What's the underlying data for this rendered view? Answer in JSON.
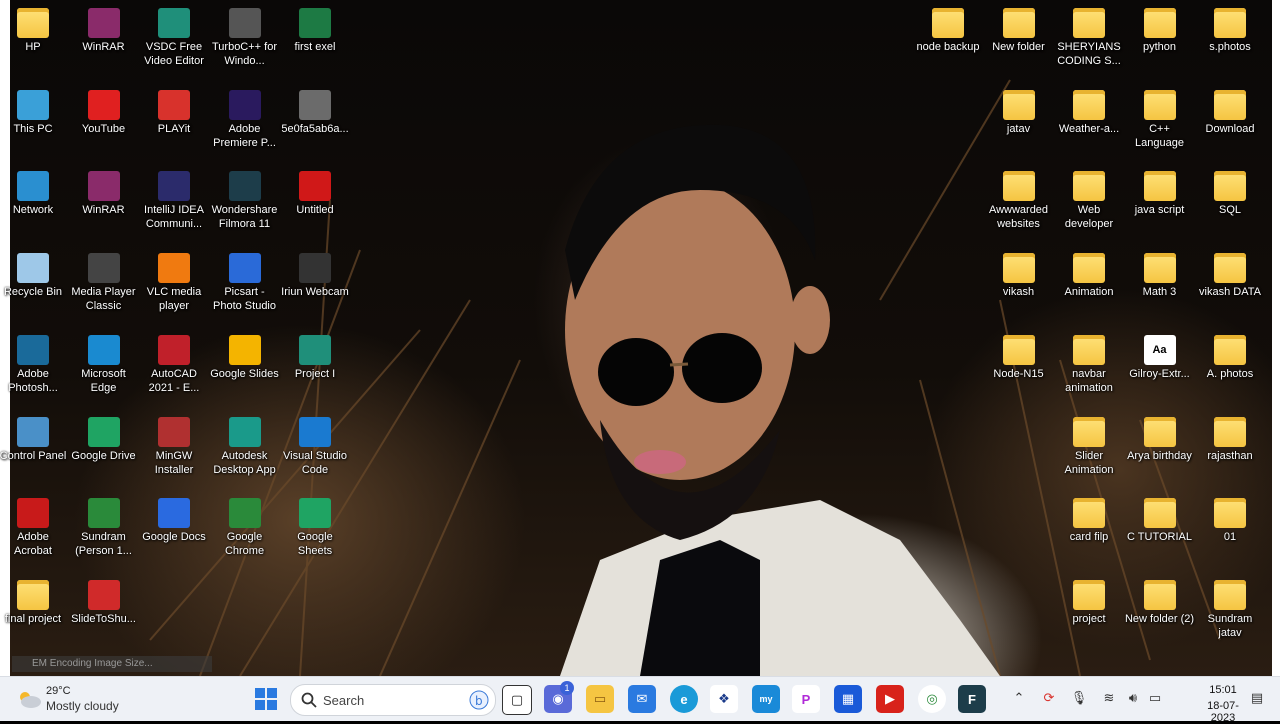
{
  "desktop_left": [
    {
      "label": "HP",
      "icon": "folder-icon",
      "color": "#f5c542"
    },
    {
      "label": "WinRAR",
      "icon": "winrar-icon",
      "color": "#8a2b6a"
    },
    {
      "label": "VSDC Free Video Editor",
      "icon": "vsdc-icon",
      "color": "#1f8f7a"
    },
    {
      "label": "TurboC++ for Windo...",
      "icon": "turboc-icon",
      "color": "#555555"
    },
    {
      "label": "first exel",
      "icon": "excel-icon",
      "color": "#1d7a44"
    },
    {
      "label": "This PC",
      "icon": "monitor-icon",
      "color": "#3aa0d8"
    },
    {
      "label": "YouTube",
      "icon": "youtube-icon",
      "color": "#e02020"
    },
    {
      "label": "PLAYit",
      "icon": "playit-icon",
      "color": "#d8322c"
    },
    {
      "label": "Adobe Premiere P...",
      "icon": "premiere-icon",
      "color": "#2a1a5e"
    },
    {
      "label": "5e0fa5ab6a...",
      "icon": "video-file-icon",
      "color": "#6b6b6b"
    },
    {
      "label": "Network",
      "icon": "network-icon",
      "color": "#2a8fd0"
    },
    {
      "label": "WinRAR",
      "icon": "winrar-icon",
      "color": "#8a2b6a"
    },
    {
      "label": "IntelliJ IDEA Communi...",
      "icon": "intellij-icon",
      "color": "#2b2b6b"
    },
    {
      "label": "Wondershare Filmora 11",
      "icon": "filmora-icon",
      "color": "#1d3d4a"
    },
    {
      "label": "Untitled",
      "icon": "red-file-icon",
      "color": "#d01818"
    },
    {
      "label": "Recycle Bin",
      "icon": "recycle-bin-icon",
      "color": "#9ec8e8"
    },
    {
      "label": "Media Player Classic",
      "icon": "media-player-icon",
      "color": "#444444"
    },
    {
      "label": "VLC media player",
      "icon": "vlc-icon",
      "color": "#f07a10"
    },
    {
      "label": "Picsart - Photo Studio",
      "icon": "picsart-icon",
      "color": "#2a6ad8"
    },
    {
      "label": "Iriun Webcam",
      "icon": "webcam-icon",
      "color": "#333333"
    },
    {
      "label": "Adobe Photosh...",
      "icon": "photoshop-icon",
      "color": "#1a6a9a"
    },
    {
      "label": "Microsoft Edge",
      "icon": "edge-icon",
      "color": "#1a8ad0"
    },
    {
      "label": "AutoCAD 2021 - E...",
      "icon": "autocad-icon",
      "color": "#c0202a"
    },
    {
      "label": "Google Slides",
      "icon": "slides-icon",
      "color": "#f4b400"
    },
    {
      "label": "Project I",
      "icon": "project-icon",
      "color": "#1f8f7a"
    },
    {
      "label": "Control Panel",
      "icon": "control-panel-icon",
      "color": "#4a90c8"
    },
    {
      "label": "Google Drive",
      "icon": "drive-icon",
      "color": "#1fa463"
    },
    {
      "label": "MinGW Installer",
      "icon": "mingw-icon",
      "color": "#b03030"
    },
    {
      "label": "Autodesk Desktop App",
      "icon": "autodesk-icon",
      "color": "#1a9a8a"
    },
    {
      "label": "Visual Studio Code",
      "icon": "vscode-icon",
      "color": "#1a7ad0"
    },
    {
      "label": "Adobe Acrobat",
      "icon": "acrobat-icon",
      "color": "#c81a1a"
    },
    {
      "label": "Sundram (Person 1...",
      "icon": "chrome-icon",
      "color": "#2a8a3a"
    },
    {
      "label": "Google Docs",
      "icon": "docs-icon",
      "color": "#2a6ae0"
    },
    {
      "label": "Google Chrome",
      "icon": "chrome-icon",
      "color": "#2a8a3a"
    },
    {
      "label": "Google Sheets",
      "icon": "sheets-icon",
      "color": "#1fa463"
    },
    {
      "label": "final project",
      "icon": "folder-icon",
      "color": "#f5c542"
    },
    {
      "label": "SlideToShu...",
      "icon": "shutdown-icon",
      "color": "#d02a2a"
    }
  ],
  "desktop_right": [
    {
      "label": "node backup",
      "icon": "folder-icon"
    },
    {
      "label": "New folder",
      "icon": "folder-icon"
    },
    {
      "label": "SHERYIANS CODING S...",
      "icon": "folder-icon"
    },
    {
      "label": "python",
      "icon": "folder-icon"
    },
    {
      "label": "s.photos",
      "icon": "folder-icon"
    },
    {
      "label": "jatav",
      "icon": "folder-icon"
    },
    {
      "label": "Weather-a...",
      "icon": "folder-icon"
    },
    {
      "label": "C++ Language",
      "icon": "folder-icon"
    },
    {
      "label": "Download",
      "icon": "folder-icon"
    },
    {
      "label": "Awwwarded websites",
      "icon": "folder-icon"
    },
    {
      "label": "Web developer",
      "icon": "folder-icon"
    },
    {
      "label": "java script",
      "icon": "folder-icon"
    },
    {
      "label": "SQL",
      "icon": "folder-icon"
    },
    {
      "label": "vikash",
      "icon": "folder-icon"
    },
    {
      "label": "Animation",
      "icon": "folder-icon"
    },
    {
      "label": "Math 3",
      "icon": "folder-icon"
    },
    {
      "label": "vikash DATA",
      "icon": "folder-icon"
    },
    {
      "label": "Node-N15",
      "icon": "folder-icon"
    },
    {
      "label": "navbar animation",
      "icon": "folder-icon"
    },
    {
      "label": "Gilroy-Extr...",
      "icon": "font-file-icon"
    },
    {
      "label": "A. photos",
      "icon": "folder-icon"
    },
    {
      "label": "Slider Animation",
      "icon": "folder-icon"
    },
    {
      "label": "Arya birthday",
      "icon": "folder-icon"
    },
    {
      "label": "rajasthan",
      "icon": "folder-icon"
    },
    {
      "label": "card filp",
      "icon": "folder-icon"
    },
    {
      "label": "C TUTORIAL",
      "icon": "folder-icon"
    },
    {
      "label": "01",
      "icon": "folder-icon"
    },
    {
      "label": "project",
      "icon": "folder-icon"
    },
    {
      "label": "New folder (2)",
      "icon": "folder-icon"
    },
    {
      "label": "Sundram jatav",
      "icon": "folder-icon"
    }
  ],
  "font_file_glyph": "Aa",
  "taskbar": {
    "weather_temp": "29°C",
    "weather_desc": "Mostly cloudy",
    "search_label": "Search",
    "chat_badge": "1",
    "time": "15:01",
    "date": "18-07-2023",
    "colors": {
      "taskbar_bg": "#eef1f6",
      "start": "#2a7ae0",
      "accent": "#3a62d8"
    }
  },
  "clip_note": "EM Encoding Image Size..."
}
